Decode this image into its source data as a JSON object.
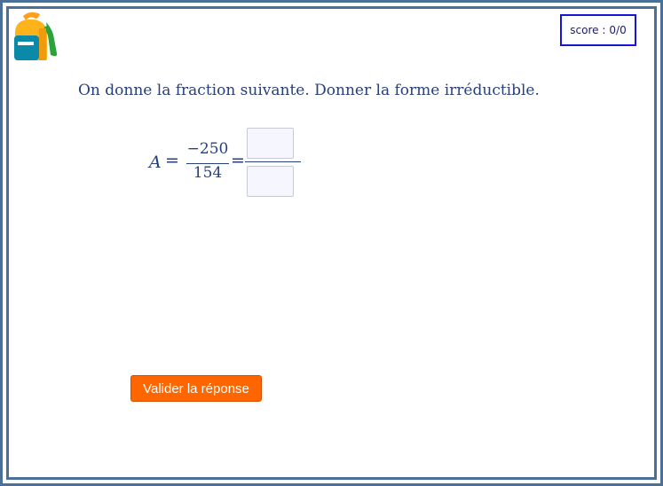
{
  "score": {
    "label": "score :",
    "value": "0/0"
  },
  "question": {
    "text": "On donne la fraction suivante. Donner la forme irréductible."
  },
  "expression": {
    "variable": "A",
    "equals": "=",
    "numerator": "−250",
    "denominator": "154",
    "equals_after": "="
  },
  "answer": {
    "numerator_value": "",
    "denominator_value": ""
  },
  "submit": {
    "label": "Valider la réponse"
  },
  "colors": {
    "frame": "#4a6f99",
    "text": "#27407a",
    "score_border": "#1515d6",
    "button": "#ff6600"
  },
  "icons": {
    "logo": "backpack-icon"
  }
}
